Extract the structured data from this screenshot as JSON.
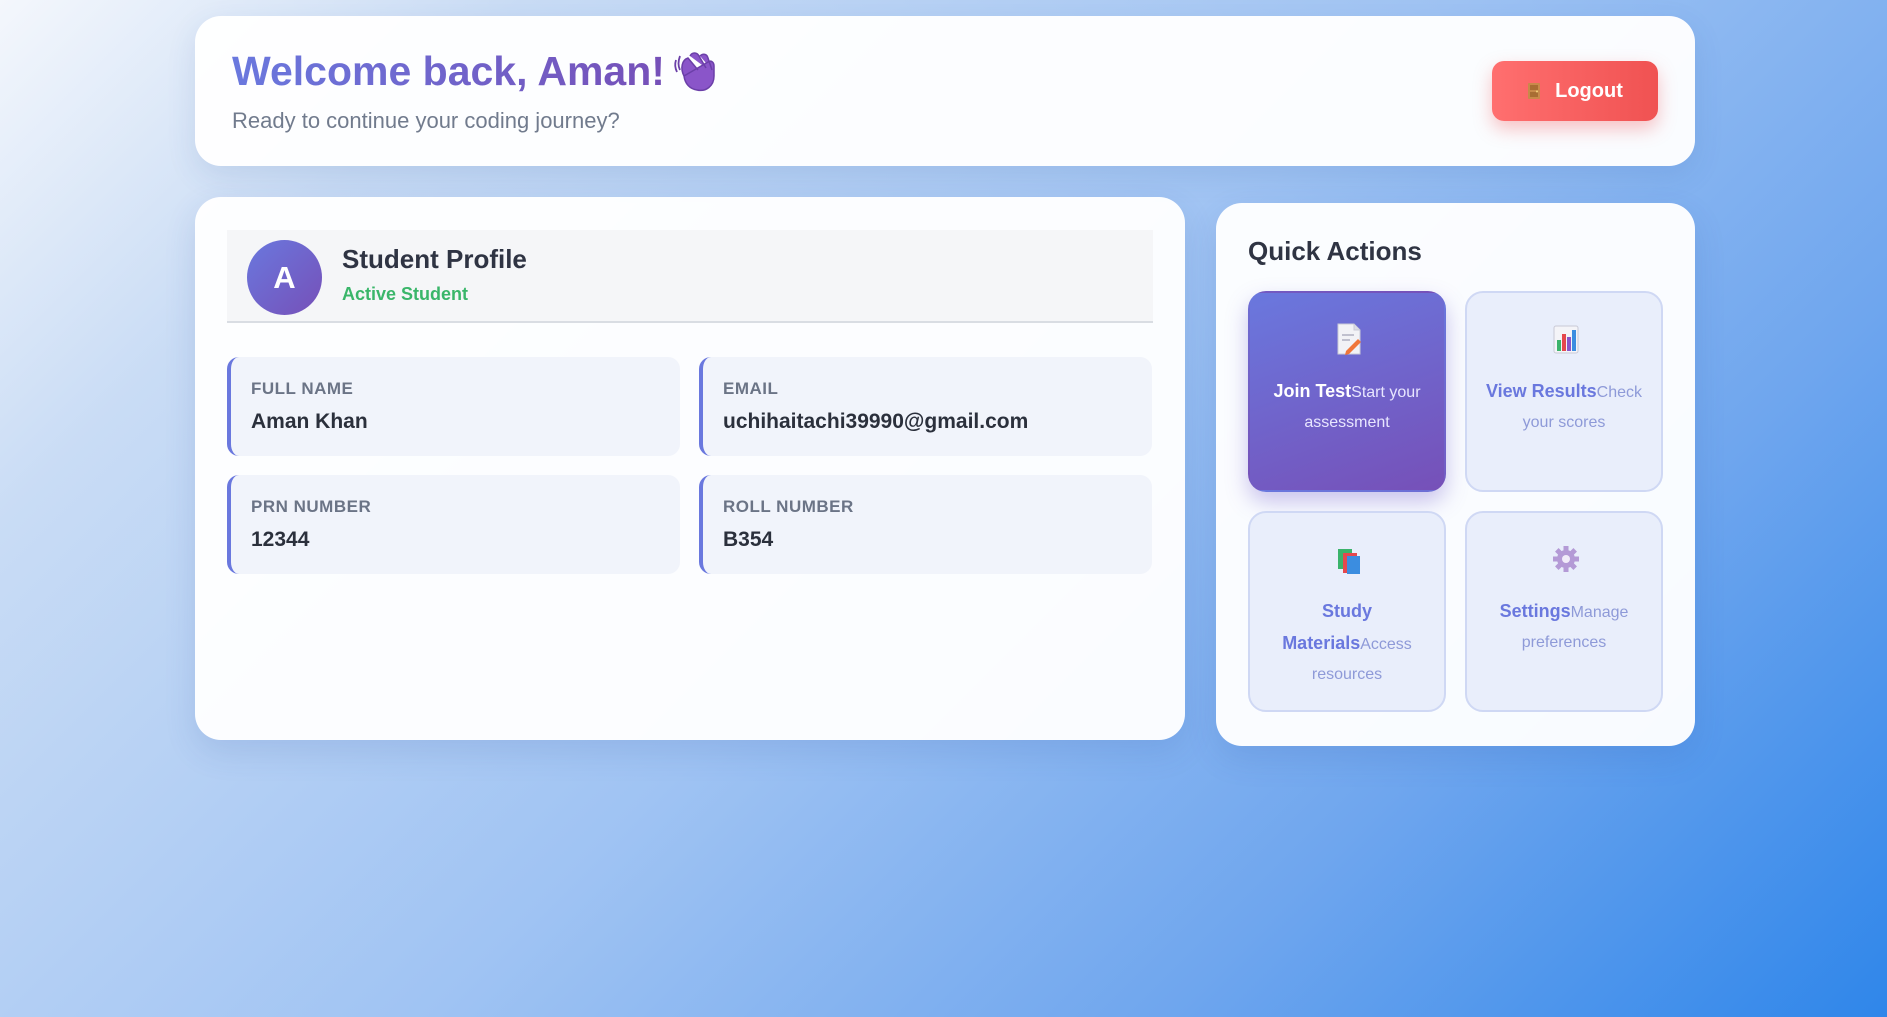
{
  "header": {
    "welcome": "Welcome back, Aman!",
    "wave_icon": "waving-hand-icon",
    "subtitle": "Ready to continue your coding journey?",
    "logout_label": "Logout",
    "logout_icon": "door-icon"
  },
  "profile": {
    "avatar_letter": "A",
    "title": "Student Profile",
    "status": "Active Student",
    "fields": [
      {
        "label": "FULL NAME",
        "value": "Aman Khan"
      },
      {
        "label": "EMAIL",
        "value": "uchihaitachi39990@gmail.com"
      },
      {
        "label": "PRN NUMBER",
        "value": "12344"
      },
      {
        "label": "ROLL NUMBER",
        "value": "B354"
      }
    ]
  },
  "quick_actions": {
    "title": "Quick Actions",
    "items": [
      {
        "label": "Join Test",
        "desc": "Start your assessment",
        "icon": "memo-icon",
        "active": true
      },
      {
        "label": "View Results",
        "desc": "Check your scores",
        "icon": "bar-chart-icon",
        "active": false
      },
      {
        "label": "Study Materials",
        "desc": "Access resources",
        "icon": "books-icon",
        "active": false
      },
      {
        "label": "Settings",
        "desc": "Manage preferences",
        "icon": "gear-icon",
        "active": false
      }
    ]
  },
  "colors": {
    "accent": "#6a78de",
    "accent_dark": "#7650b8",
    "logout": "#f05252",
    "status_green": "#3ab66a"
  }
}
